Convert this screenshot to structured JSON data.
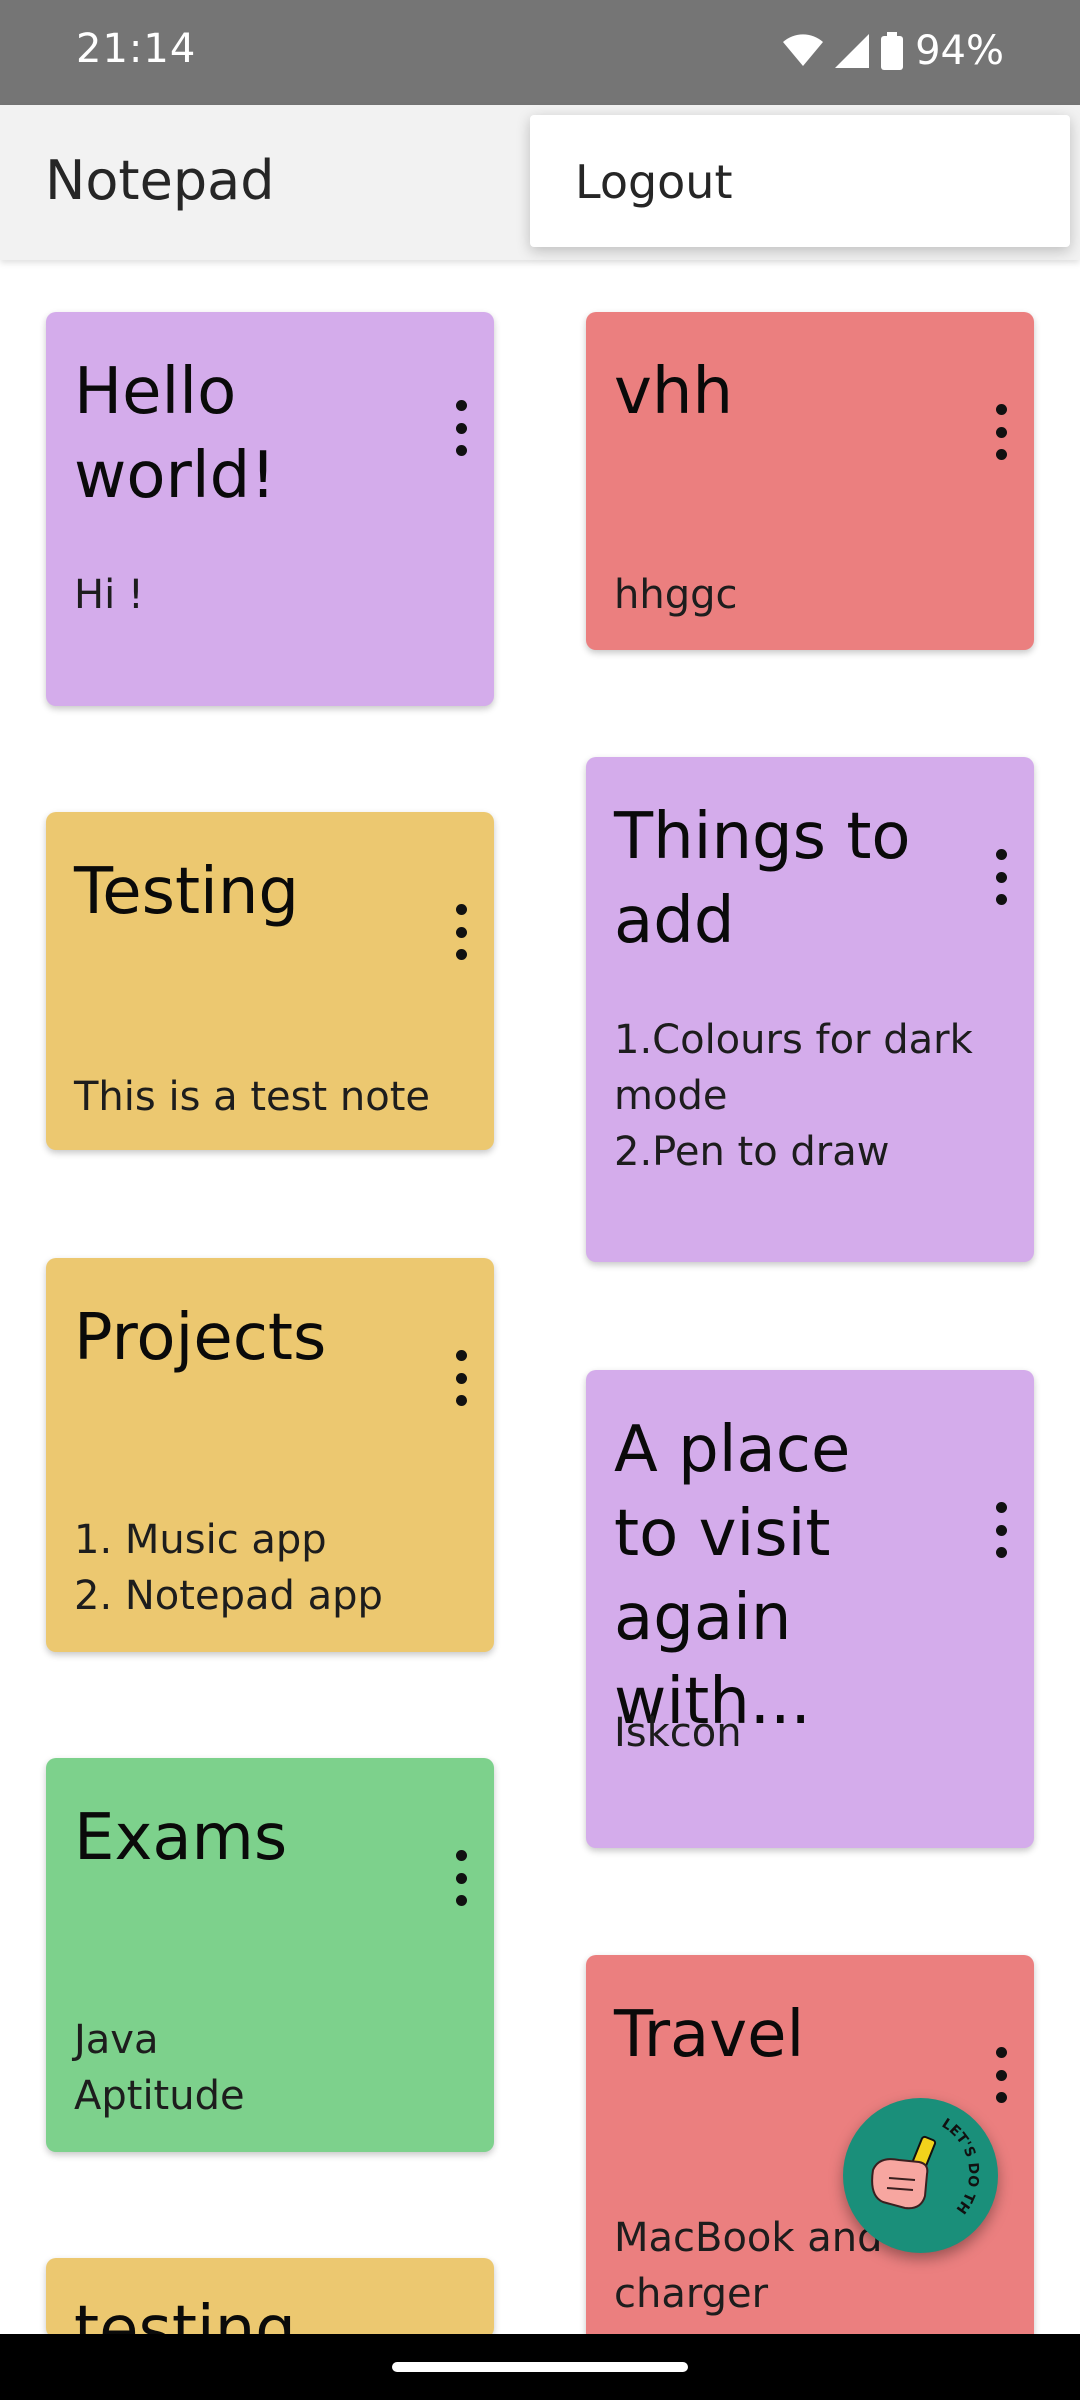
{
  "status_bar": {
    "time": "21:14",
    "battery": "94%"
  },
  "app_bar": {
    "title": "Notepad"
  },
  "menu": {
    "logout_label": "Logout"
  },
  "notes": [
    {
      "title": "Hello world!",
      "body": "Hi !",
      "color": "#d4aceb"
    },
    {
      "title": "vhh",
      "body": "hhggc",
      "color": "#eb7f7f"
    },
    {
      "title": "Testing",
      "body": "This is a test note",
      "color": "#ecc870"
    },
    {
      "title": "Things to add",
      "body": "1.Colours for dark mode\n2.Pen to draw",
      "color": "#d4aceb"
    },
    {
      "title": "Projects",
      "body": "1. Music app\n2. Notepad app",
      "color": "#ecc870"
    },
    {
      "title": "A place to visit again with...",
      "body": "Iskcon",
      "color": "#d4aceb"
    },
    {
      "title": "Exams",
      "body": "Java\nAptitude",
      "color": "#7dd18c"
    },
    {
      "title": "Travel",
      "body": "MacBook and charger",
      "color": "#eb7f7f"
    },
    {
      "title": "testing",
      "body": "",
      "color": "#ecc870"
    }
  ],
  "fab": {
    "badge_text": "LET'S DO THIS",
    "color": "#1a8f7a"
  },
  "colors": {
    "status_bar": "#757575",
    "app_bar": "#f2f2f2",
    "nav_bar": "#000000"
  }
}
